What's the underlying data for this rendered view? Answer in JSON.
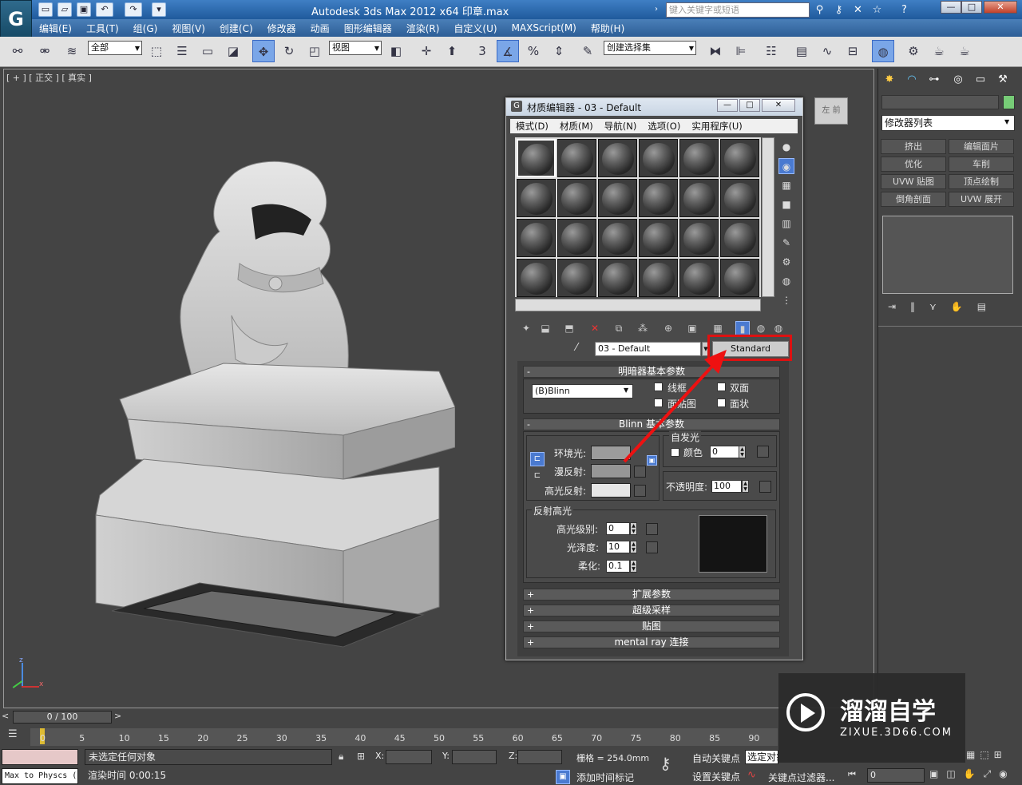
{
  "window": {
    "title": "Autodesk 3ds Max  2012 x64      印章.max",
    "search_placeholder": "键入关键字或短语",
    "min": "—",
    "max": "□",
    "close": "✕"
  },
  "menubar": [
    "编辑(E)",
    "工具(T)",
    "组(G)",
    "视图(V)",
    "创建(C)",
    "修改器",
    "动画",
    "图形编辑器",
    "渲染(R)",
    "自定义(U)",
    "MAXScript(M)",
    "帮助(H)"
  ],
  "toolbar": {
    "selection_filter": "全部",
    "ref_coord": "视图",
    "named_selection": "创建选择集",
    "snap_label": "3"
  },
  "viewport": {
    "label": "[ + ] [ 正交 ] [ 真实 ]",
    "viewcube_label": "左 前",
    "axis_z": "z",
    "axis_x": "x"
  },
  "command_panel": {
    "modifier_list": "修改器列表",
    "buttons": [
      "挤出",
      "编辑面片",
      "优化",
      "车削",
      "UVW 贴图",
      "顶点绘制",
      "倒角剖面",
      "UVW 展开"
    ]
  },
  "material_editor": {
    "title": "材质编辑器 - 03 - Default",
    "menus": [
      "模式(D)",
      "材质(M)",
      "导航(N)",
      "选项(O)",
      "实用程序(U)"
    ],
    "material_name": "03 - Default",
    "type_button": "Standard",
    "shader_rollout": {
      "title": "明暗器基本参数",
      "shader": "(B)Blinn",
      "wire": "线框",
      "two_sided": "双面",
      "face_map": "面贴图",
      "faceted": "面状"
    },
    "blinn_rollout": {
      "title": "Blinn 基本参数",
      "self_illum_group": "自发光",
      "color_label": "颜色",
      "self_illum_value": "0",
      "ambient": "环境光:",
      "diffuse": "漫反射:",
      "specular": "高光反射:",
      "opacity_label": "不透明度:",
      "opacity_value": "100",
      "highlight_group": "反射高光",
      "spec_level_label": "高光级别:",
      "spec_level": "0",
      "glossiness_label": "光泽度:",
      "glossiness": "10",
      "soften_label": "柔化:",
      "soften": "0.1"
    },
    "collapsed_rollouts": [
      "扩展参数",
      "超级采样",
      "贴图",
      "mental ray 连接"
    ]
  },
  "timeline": {
    "frame_counter": "0 / 100",
    "ticks": [
      "0",
      "5",
      "10",
      "15",
      "20",
      "25",
      "30",
      "35",
      "40",
      "45",
      "50",
      "55",
      "60",
      "65",
      "70",
      "75",
      "80",
      "85",
      "90"
    ]
  },
  "status": {
    "selection": "未选定任何对象",
    "render_time": "渲染时间  0:00:15",
    "maxscript": "Max to Physcs (",
    "x_label": "X:",
    "y_label": "Y:",
    "z_label": "Z:",
    "grid": "栅格 = 254.0mm",
    "add_time_tag": "添加时间标记",
    "auto_key": "自动关键点",
    "selected": "选定对象",
    "set_key": "设置关键点",
    "key_filters": "关键点过滤器...",
    "current_frame": "0"
  },
  "watermark": {
    "brand": "溜溜自学",
    "url": "ZIXUE.3D66.COM"
  },
  "colors": {
    "highlight": "#dd1111",
    "titlebar": "#2d66a8"
  }
}
